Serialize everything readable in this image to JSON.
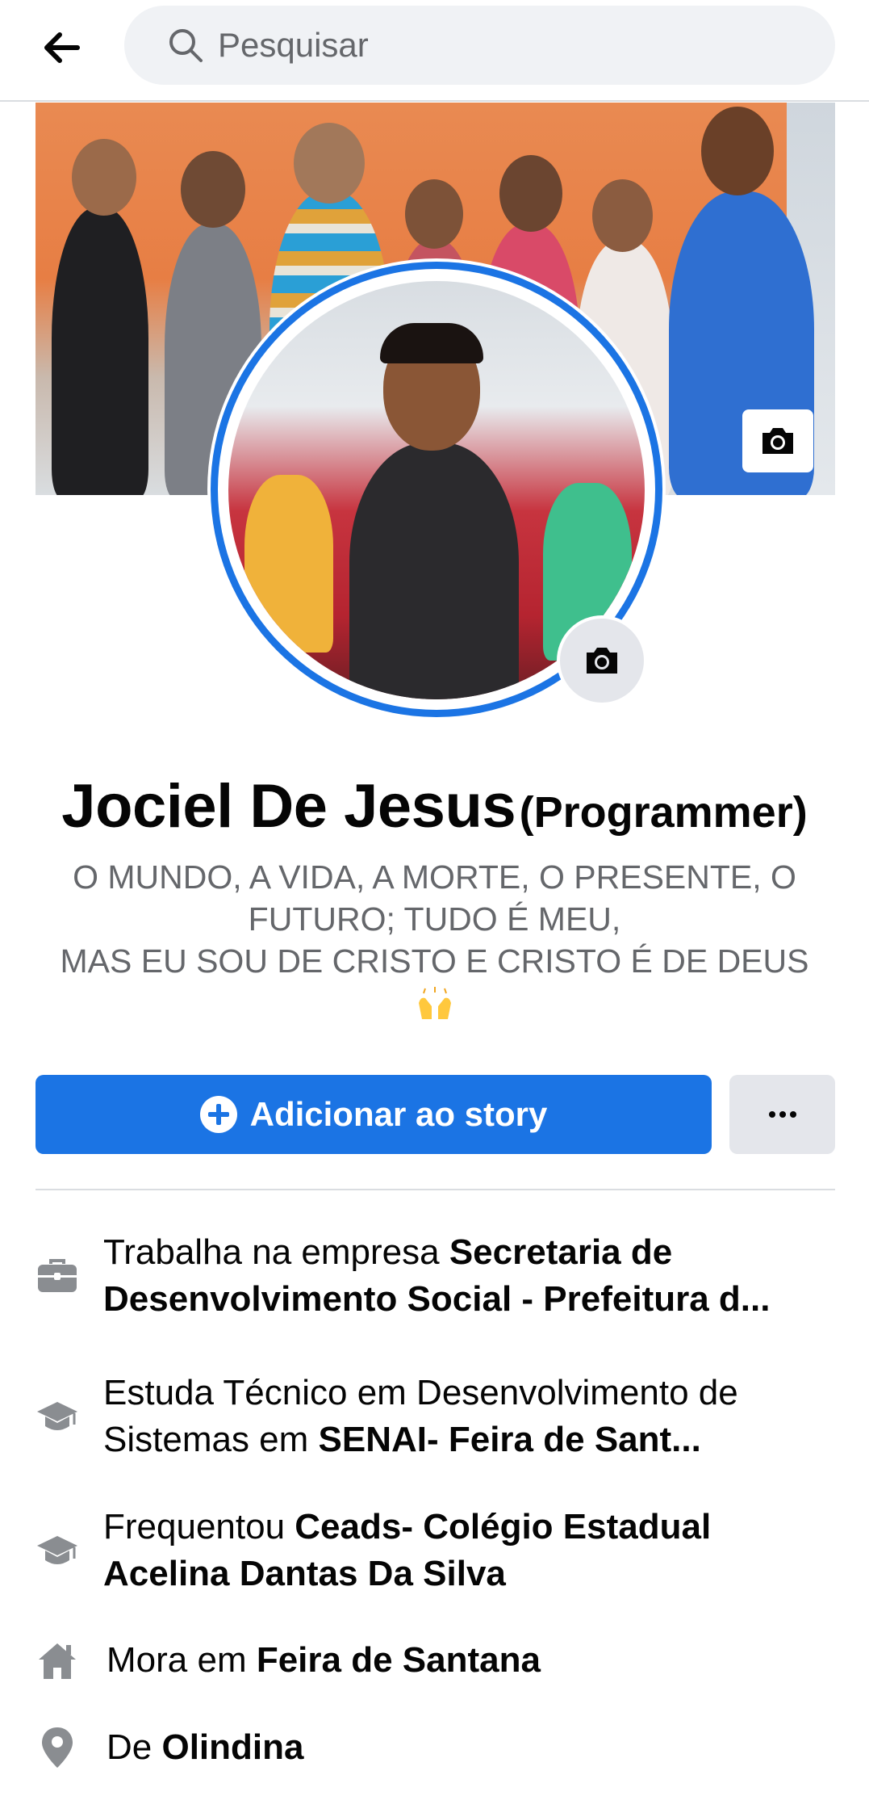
{
  "header": {
    "back_icon": "arrow-left-icon",
    "search_icon": "search-icon",
    "search_placeholder": "Pesquisar"
  },
  "cover": {
    "camera_icon": "camera-icon"
  },
  "avatar": {
    "camera_icon": "camera-icon"
  },
  "profile": {
    "name": "Jociel De Jesus",
    "alternate_name": "(Programmer)",
    "bio_line1": "O MUNDO, A VIDA, A MORTE, O PRESENTE, O FUTURO; TUDO É MEU,",
    "bio_line2": "MAS EU SOU DE CRISTO E CRISTO É DE DEUS",
    "bio_emoji": "🙌"
  },
  "actions": {
    "add_story_label": "Adicionar ao story",
    "add_story_icon": "plus-circle-icon",
    "more_icon": "more-dots-icon"
  },
  "intro": [
    {
      "icon": "briefcase-icon",
      "prefix": "Trabalha na empresa ",
      "bold": "Secretaria de Desenvolvimento Social - Prefeitura d..."
    },
    {
      "icon": "graduation-cap-icon",
      "prefix": "Estuda Técnico em Desenvolvimento de Sistemas em ",
      "bold": "SENAI- Feira de Sant..."
    },
    {
      "icon": "graduation-cap-icon",
      "prefix": "Frequentou ",
      "bold": "Ceads- Colégio Estadual Acelina Dantas Da Silva"
    },
    {
      "icon": "home-icon",
      "prefix": "Mora em ",
      "bold": "Feira de Santana"
    },
    {
      "icon": "location-pin-icon",
      "prefix": "De ",
      "bold": "Olindina"
    }
  ],
  "colors": {
    "accent": "#1b74e4",
    "secondary_text": "#65676b",
    "button_gray": "#e4e6eb",
    "icon_gray": "#8a8d91"
  }
}
